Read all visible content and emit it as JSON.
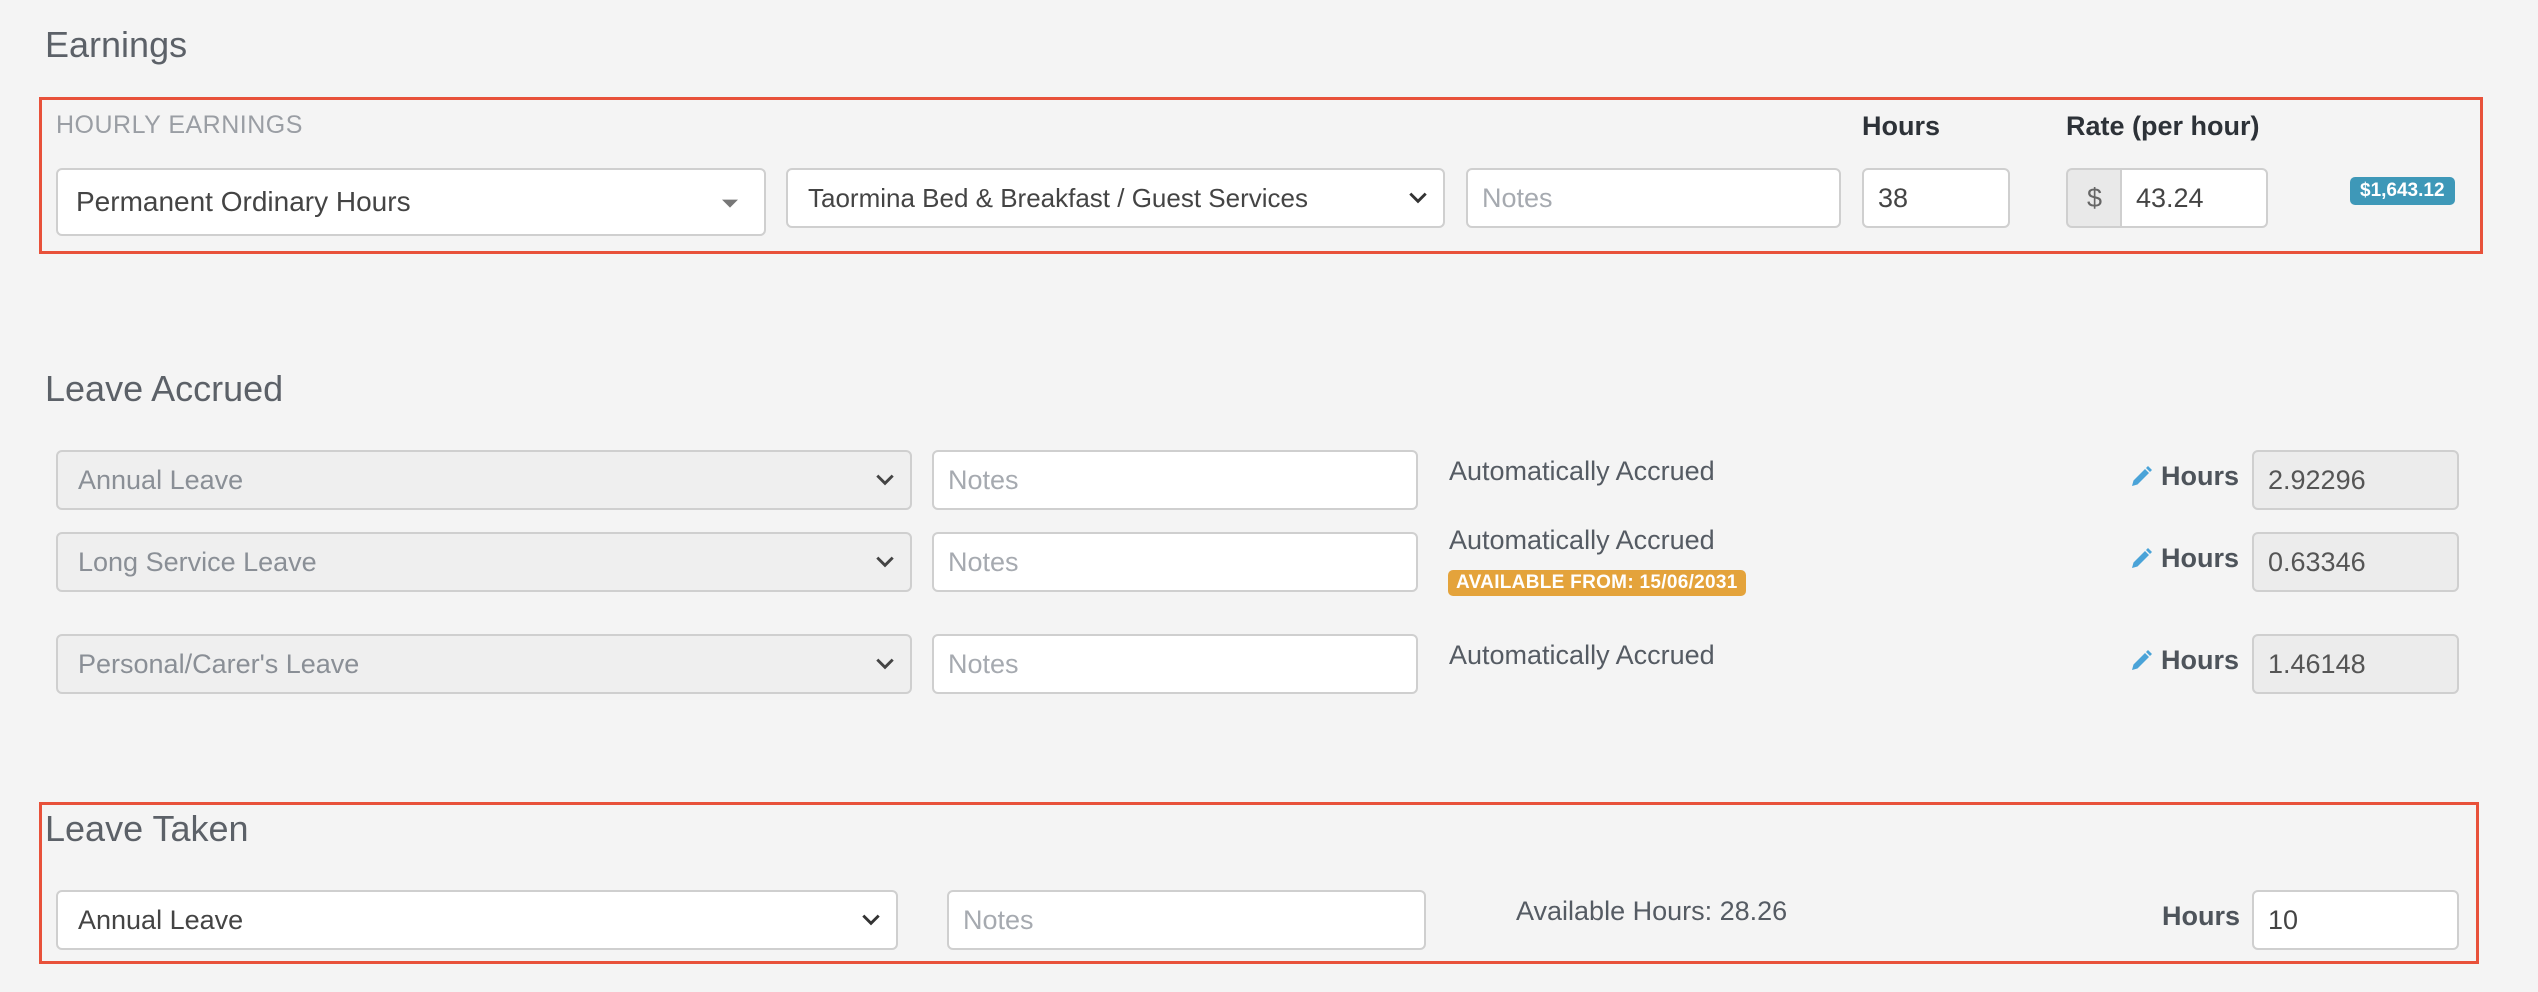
{
  "earnings": {
    "title": "Earnings",
    "section_label": "HOURLY EARNINGS",
    "hours_header": "Hours",
    "rate_header": "Rate (per hour)",
    "pay_category": "Permanent Ordinary Hours",
    "location": "Taormina Bed & Breakfast / Guest Services",
    "notes_placeholder": "Notes",
    "hours": "38",
    "currency_symbol": "$",
    "rate": "43.24",
    "total": "$1,643.12"
  },
  "leave_accrued": {
    "title": "Leave Accrued",
    "rows": [
      {
        "category": "Annual Leave",
        "notes_placeholder": "Notes",
        "status": "Automatically Accrued",
        "hours_label": "Hours",
        "hours": "2.92296"
      },
      {
        "category": "Long Service Leave",
        "notes_placeholder": "Notes",
        "status": "Automatically Accrued",
        "available_badge": "AVAILABLE FROM: 15/06/2031",
        "hours_label": "Hours",
        "hours": "0.63346"
      },
      {
        "category": "Personal/Carer's Leave",
        "notes_placeholder": "Notes",
        "status": "Automatically Accrued",
        "hours_label": "Hours",
        "hours": "1.46148"
      }
    ]
  },
  "leave_taken": {
    "title": "Leave Taken",
    "category": "Annual Leave",
    "notes_placeholder": "Notes",
    "available_hours": "Available Hours: 28.26",
    "hours_label": "Hours",
    "hours": "10"
  },
  "colors": {
    "highlight_border": "#e8513a",
    "total_badge": "#3e98b8",
    "available_badge": "#e4a33b",
    "pencil_icon": "#4aa3d8"
  }
}
